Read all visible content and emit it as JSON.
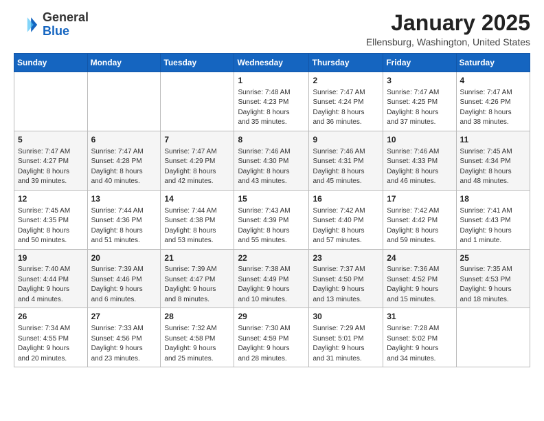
{
  "header": {
    "logo_general": "General",
    "logo_blue": "Blue",
    "month_title": "January 2025",
    "location": "Ellensburg, Washington, United States"
  },
  "days_of_week": [
    "Sunday",
    "Monday",
    "Tuesday",
    "Wednesday",
    "Thursday",
    "Friday",
    "Saturday"
  ],
  "weeks": [
    [
      {
        "day": "",
        "info": ""
      },
      {
        "day": "",
        "info": ""
      },
      {
        "day": "",
        "info": ""
      },
      {
        "day": "1",
        "info": "Sunrise: 7:48 AM\nSunset: 4:23 PM\nDaylight: 8 hours\nand 35 minutes."
      },
      {
        "day": "2",
        "info": "Sunrise: 7:47 AM\nSunset: 4:24 PM\nDaylight: 8 hours\nand 36 minutes."
      },
      {
        "day": "3",
        "info": "Sunrise: 7:47 AM\nSunset: 4:25 PM\nDaylight: 8 hours\nand 37 minutes."
      },
      {
        "day": "4",
        "info": "Sunrise: 7:47 AM\nSunset: 4:26 PM\nDaylight: 8 hours\nand 38 minutes."
      }
    ],
    [
      {
        "day": "5",
        "info": "Sunrise: 7:47 AM\nSunset: 4:27 PM\nDaylight: 8 hours\nand 39 minutes."
      },
      {
        "day": "6",
        "info": "Sunrise: 7:47 AM\nSunset: 4:28 PM\nDaylight: 8 hours\nand 40 minutes."
      },
      {
        "day": "7",
        "info": "Sunrise: 7:47 AM\nSunset: 4:29 PM\nDaylight: 8 hours\nand 42 minutes."
      },
      {
        "day": "8",
        "info": "Sunrise: 7:46 AM\nSunset: 4:30 PM\nDaylight: 8 hours\nand 43 minutes."
      },
      {
        "day": "9",
        "info": "Sunrise: 7:46 AM\nSunset: 4:31 PM\nDaylight: 8 hours\nand 45 minutes."
      },
      {
        "day": "10",
        "info": "Sunrise: 7:46 AM\nSunset: 4:33 PM\nDaylight: 8 hours\nand 46 minutes."
      },
      {
        "day": "11",
        "info": "Sunrise: 7:45 AM\nSunset: 4:34 PM\nDaylight: 8 hours\nand 48 minutes."
      }
    ],
    [
      {
        "day": "12",
        "info": "Sunrise: 7:45 AM\nSunset: 4:35 PM\nDaylight: 8 hours\nand 50 minutes."
      },
      {
        "day": "13",
        "info": "Sunrise: 7:44 AM\nSunset: 4:36 PM\nDaylight: 8 hours\nand 51 minutes."
      },
      {
        "day": "14",
        "info": "Sunrise: 7:44 AM\nSunset: 4:38 PM\nDaylight: 8 hours\nand 53 minutes."
      },
      {
        "day": "15",
        "info": "Sunrise: 7:43 AM\nSunset: 4:39 PM\nDaylight: 8 hours\nand 55 minutes."
      },
      {
        "day": "16",
        "info": "Sunrise: 7:42 AM\nSunset: 4:40 PM\nDaylight: 8 hours\nand 57 minutes."
      },
      {
        "day": "17",
        "info": "Sunrise: 7:42 AM\nSunset: 4:42 PM\nDaylight: 8 hours\nand 59 minutes."
      },
      {
        "day": "18",
        "info": "Sunrise: 7:41 AM\nSunset: 4:43 PM\nDaylight: 9 hours\nand 1 minute."
      }
    ],
    [
      {
        "day": "19",
        "info": "Sunrise: 7:40 AM\nSunset: 4:44 PM\nDaylight: 9 hours\nand 4 minutes."
      },
      {
        "day": "20",
        "info": "Sunrise: 7:39 AM\nSunset: 4:46 PM\nDaylight: 9 hours\nand 6 minutes."
      },
      {
        "day": "21",
        "info": "Sunrise: 7:39 AM\nSunset: 4:47 PM\nDaylight: 9 hours\nand 8 minutes."
      },
      {
        "day": "22",
        "info": "Sunrise: 7:38 AM\nSunset: 4:49 PM\nDaylight: 9 hours\nand 10 minutes."
      },
      {
        "day": "23",
        "info": "Sunrise: 7:37 AM\nSunset: 4:50 PM\nDaylight: 9 hours\nand 13 minutes."
      },
      {
        "day": "24",
        "info": "Sunrise: 7:36 AM\nSunset: 4:52 PM\nDaylight: 9 hours\nand 15 minutes."
      },
      {
        "day": "25",
        "info": "Sunrise: 7:35 AM\nSunset: 4:53 PM\nDaylight: 9 hours\nand 18 minutes."
      }
    ],
    [
      {
        "day": "26",
        "info": "Sunrise: 7:34 AM\nSunset: 4:55 PM\nDaylight: 9 hours\nand 20 minutes."
      },
      {
        "day": "27",
        "info": "Sunrise: 7:33 AM\nSunset: 4:56 PM\nDaylight: 9 hours\nand 23 minutes."
      },
      {
        "day": "28",
        "info": "Sunrise: 7:32 AM\nSunset: 4:58 PM\nDaylight: 9 hours\nand 25 minutes."
      },
      {
        "day": "29",
        "info": "Sunrise: 7:30 AM\nSunset: 4:59 PM\nDaylight: 9 hours\nand 28 minutes."
      },
      {
        "day": "30",
        "info": "Sunrise: 7:29 AM\nSunset: 5:01 PM\nDaylight: 9 hours\nand 31 minutes."
      },
      {
        "day": "31",
        "info": "Sunrise: 7:28 AM\nSunset: 5:02 PM\nDaylight: 9 hours\nand 34 minutes."
      },
      {
        "day": "",
        "info": ""
      }
    ]
  ]
}
